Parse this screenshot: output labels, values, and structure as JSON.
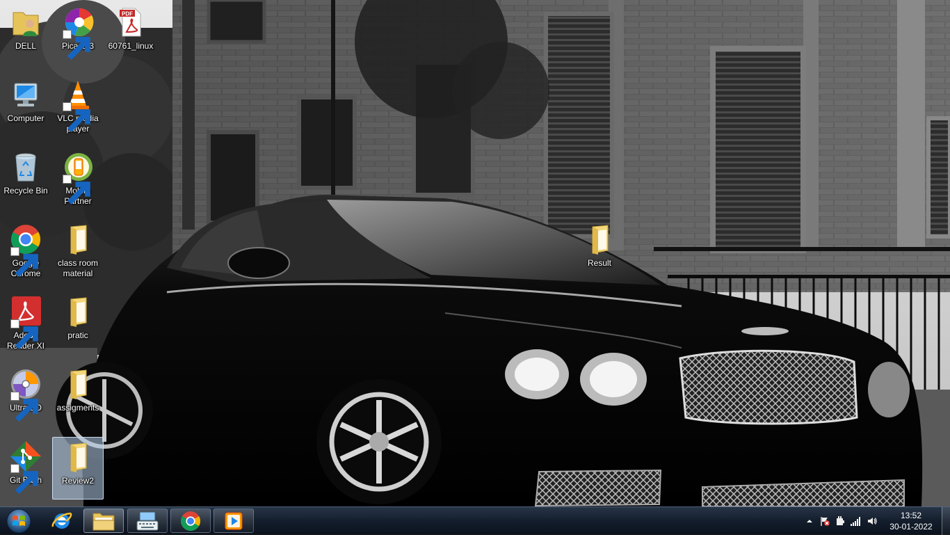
{
  "desktop": {
    "icons": [
      {
        "label": "DELL",
        "icon": "user-folder-icon"
      },
      {
        "label": "Picasa 3",
        "icon": "picasa-icon"
      },
      {
        "label": "60761_linux",
        "icon": "pdf-file-icon"
      },
      {
        "label": "Computer",
        "icon": "computer-icon"
      },
      {
        "label": "VLC media player",
        "icon": "vlc-icon"
      },
      {
        "label": "Recycle Bin",
        "icon": "recycle-bin-icon"
      },
      {
        "label": "Mobile Partner",
        "icon": "mobile-partner-icon"
      },
      {
        "label": "Google Chrome",
        "icon": "chrome-icon"
      },
      {
        "label": "class room material",
        "icon": "folder-icon"
      },
      {
        "label": "Adobe Reader XI",
        "icon": "adobe-reader-icon"
      },
      {
        "label": "pratic",
        "icon": "folder-icon"
      },
      {
        "label": "UltraISO",
        "icon": "ultraiso-icon"
      },
      {
        "label": "assigments",
        "icon": "folder-icon"
      },
      {
        "label": "Git Bash",
        "icon": "git-bash-icon"
      },
      {
        "label": "Review2",
        "icon": "folder-icon",
        "selected": true
      },
      {
        "label": "Result",
        "icon": "folder-icon"
      }
    ]
  },
  "taskbar": {
    "start": {
      "icon": "windows-start-icon"
    },
    "buttons": [
      {
        "icon": "internet-explorer-icon"
      },
      {
        "icon": "windows-explorer-icon"
      },
      {
        "icon": "on-screen-keyboard-icon"
      },
      {
        "icon": "chrome-icon"
      },
      {
        "icon": "media-player-icon"
      }
    ],
    "tray": {
      "icons": [
        "show-hidden-icons-arrow",
        "action-center-flag-icon",
        "power-icon",
        "network-signal-icon",
        "volume-icon"
      ],
      "time": "13:52",
      "date": "30-01-2022"
    }
  }
}
